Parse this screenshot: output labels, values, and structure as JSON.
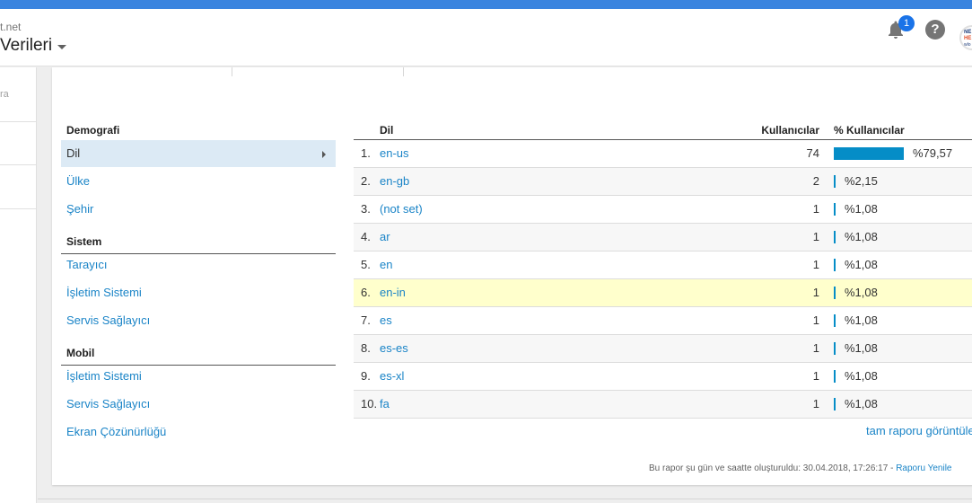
{
  "header": {
    "account": "t.net",
    "view_title": "Verileri",
    "notification_count": "1",
    "help_label": "?",
    "avatar_lines": [
      "NE",
      "HE",
      "wlo"
    ]
  },
  "leftnav": {
    "fragment": "ra"
  },
  "sections": [
    {
      "title": "Demografi",
      "items": [
        "Dil",
        "Ülke",
        "Şehir"
      ]
    },
    {
      "title": "Sistem",
      "items": [
        "Tarayıcı",
        "İşletim Sistemi",
        "Servis Sağlayıcı"
      ]
    },
    {
      "title": "Mobil",
      "items": [
        "İşletim Sistemi",
        "Servis Sağlayıcı",
        "Ekran Çözünürlüğü"
      ]
    }
  ],
  "selected_item": "Dil",
  "table": {
    "headers": {
      "dimension": "Dil",
      "users": "Kullanıcılar",
      "pct_users": "% Kullanıcılar"
    },
    "rows": [
      {
        "rank": "1.",
        "lang": "en-us",
        "users": "74",
        "pct": "%79,57",
        "share": 0.7957
      },
      {
        "rank": "2.",
        "lang": "en-gb",
        "users": "2",
        "pct": "%2,15",
        "share": 0.0215
      },
      {
        "rank": "3.",
        "lang": "(not set)",
        "users": "1",
        "pct": "%1,08",
        "share": 0.0108
      },
      {
        "rank": "4.",
        "lang": "ar",
        "users": "1",
        "pct": "%1,08",
        "share": 0.0108
      },
      {
        "rank": "5.",
        "lang": "en",
        "users": "1",
        "pct": "%1,08",
        "share": 0.0108
      },
      {
        "rank": "6.",
        "lang": "en-in",
        "users": "1",
        "pct": "%1,08",
        "share": 0.0108
      },
      {
        "rank": "7.",
        "lang": "es",
        "users": "1",
        "pct": "%1,08",
        "share": 0.0108
      },
      {
        "rank": "8.",
        "lang": "es-es",
        "users": "1",
        "pct": "%1,08",
        "share": 0.0108
      },
      {
        "rank": "9.",
        "lang": "es-xl",
        "users": "1",
        "pct": "%1,08",
        "share": 0.0108
      },
      {
        "rank": "10.",
        "lang": "fa",
        "users": "1",
        "pct": "%1,08",
        "share": 0.0108
      }
    ],
    "highlighted_rank": "6.",
    "full_report_link": "tam raporu görüntüle"
  },
  "footer": {
    "generated_text": "Bu rapor şu gün ve saatte oluşturuldu: 30.04.2018, 17:26:17 - ",
    "refresh_link": "Raporu Yenile"
  },
  "colors": {
    "accent_bar": "#3a84df",
    "link": "#1a84c7",
    "data_bar": "#058dc7",
    "highlight_row": "#ffffcc",
    "selected_item": "#dceaf5"
  }
}
